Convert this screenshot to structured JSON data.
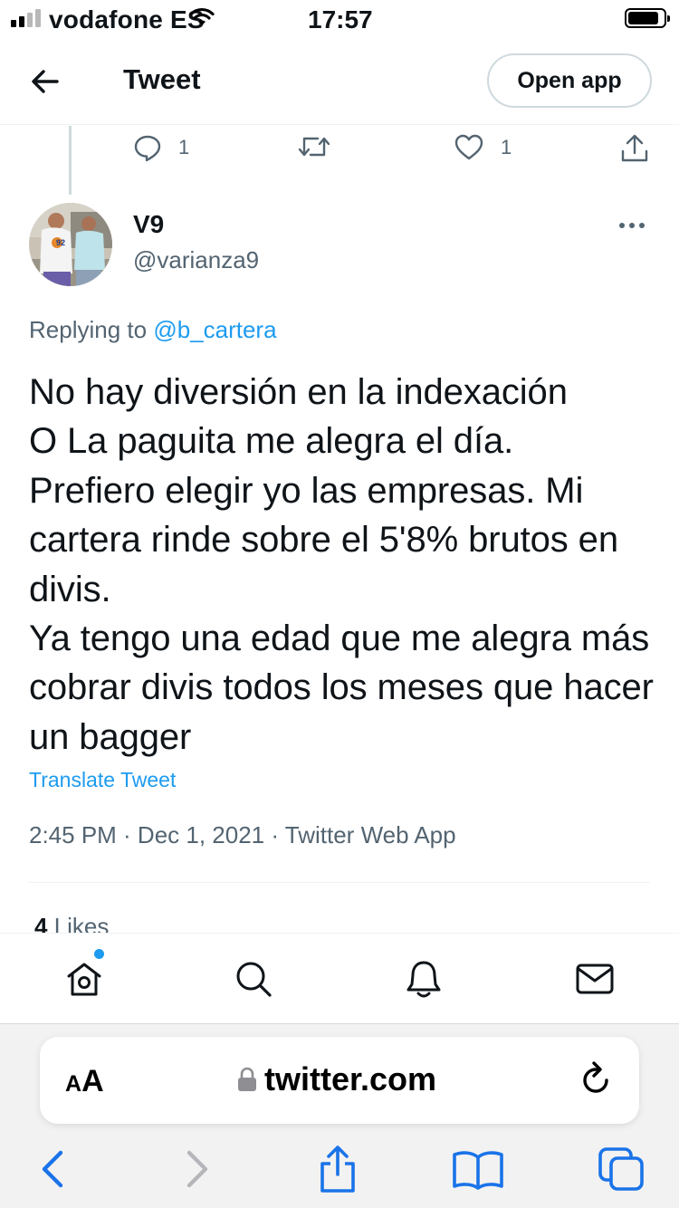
{
  "status_bar": {
    "carrier": "vodafone ES",
    "time": "17:57",
    "signal_bars_filled": 2,
    "signal_bars_total": 4,
    "wifi_icon": "wifi-icon",
    "battery_icon": "battery-icon"
  },
  "header": {
    "title": "Tweet",
    "open_app_label": "Open app",
    "back_icon": "arrow-left-icon"
  },
  "previous_tweet": {
    "reply_count": "1",
    "retweet_count": "",
    "like_count": "1"
  },
  "tweet": {
    "display_name": "V9",
    "handle": "@varianza9",
    "replying_prefix": "Replying to ",
    "replying_to": "@b_cartera",
    "text": "No hay diversión en la indexación\nO La paguita me alegra el día.\nPrefiero elegir yo las empresas. Mi cartera rinde sobre el 5'8% brutos en divis.\nYa tengo una edad que me alegra más cobrar divis todos los meses que hacer un bagger",
    "translate_label": "Translate Tweet",
    "timestamp": "2:45 PM · Dec 1, 2021 · Twitter Web App",
    "likes_count": "4",
    "likes_label": " Likes"
  },
  "bottom_nav": {
    "items": [
      "home-icon",
      "search-icon",
      "bell-icon",
      "mail-icon"
    ]
  },
  "safari": {
    "aa_label_big": "A",
    "aa_label_small": "A",
    "domain": "twitter.com",
    "lock_icon": "lock-icon",
    "toolbar": [
      "back-icon",
      "forward-icon",
      "share-icon",
      "bookmarks-icon",
      "tabs-icon"
    ]
  },
  "colors": {
    "accent": "#1d9bf0",
    "text": "#0f1419",
    "secondary": "#536471",
    "safari_blue": "#1a73e8"
  }
}
